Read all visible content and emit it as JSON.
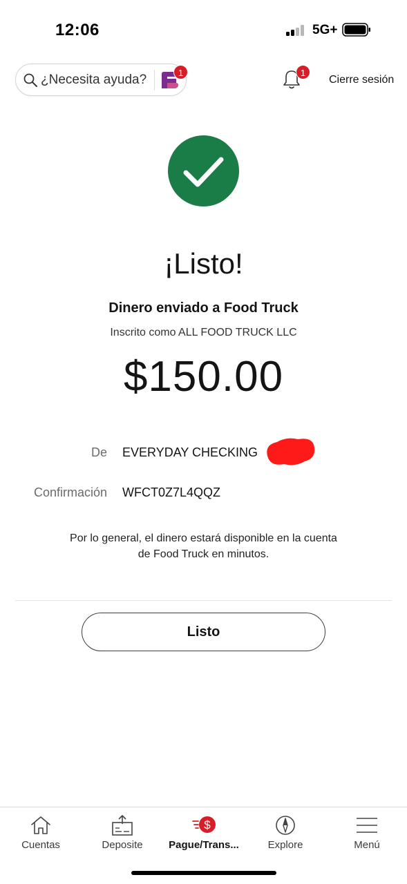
{
  "status_bar": {
    "time": "12:06",
    "network": "5G+"
  },
  "header": {
    "help_placeholder": "¿Necesita ayuda?",
    "help_badge": "1",
    "notifications_badge": "1",
    "signout_label": "Cierre sesión"
  },
  "confirmation": {
    "headline": "¡Listo!",
    "sent_to": "Dinero enviado a Food  Truck",
    "registered_as": "Inscrito como ALL FOOD TRUCK LLC",
    "amount": "$150.00",
    "from_label": "De",
    "from_value": "EVERYDAY CHECKING",
    "confirmation_label": "Confirmación",
    "confirmation_value": "WFCT0Z7L4QQZ",
    "note_line1": "Por lo general, el dinero estará disponible en la cuenta",
    "note_line2": "de Food  Truck en minutos.",
    "done_label": "Listo"
  },
  "colors": {
    "success_green": "#1a7c47",
    "badge_red": "#d71e28",
    "brand_purple": "#7b2c8f"
  },
  "tabbar": {
    "items": [
      {
        "label": "Cuentas",
        "icon": "home-icon"
      },
      {
        "label": "Deposite",
        "icon": "deposit-icon"
      },
      {
        "label": "Pague/Trans...",
        "icon": "pay-transfer-icon",
        "active": true
      },
      {
        "label": "Explore",
        "icon": "compass-icon"
      },
      {
        "label": "Menú",
        "icon": "hamburger-icon"
      }
    ]
  }
}
